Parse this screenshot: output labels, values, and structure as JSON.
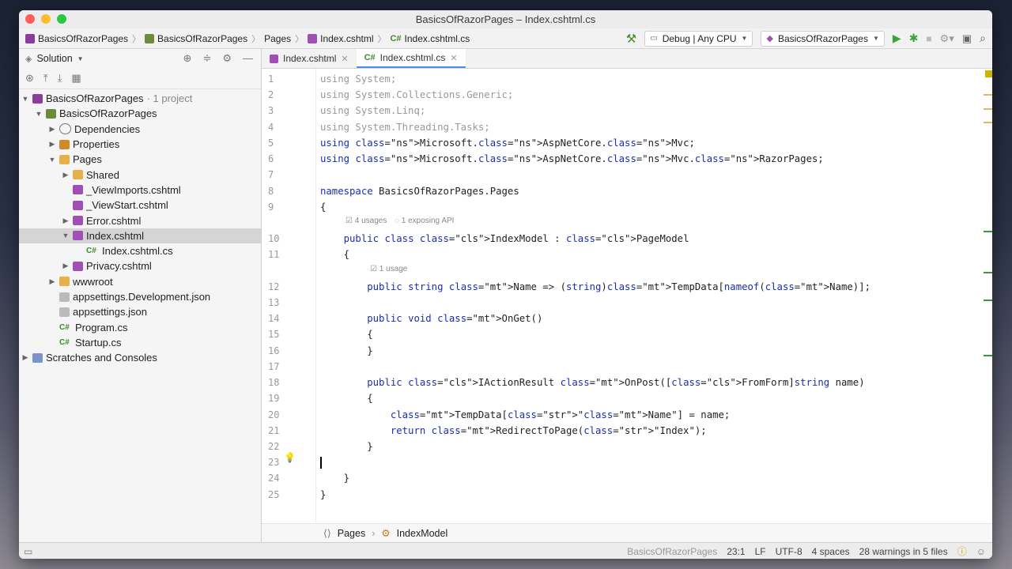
{
  "window": {
    "title": "BasicsOfRazorPages – Index.cshtml.cs"
  },
  "toolbar": {
    "breadcrumb": [
      "BasicsOfRazorPages",
      "BasicsOfRazorPages",
      "Pages",
      "Index.cshtml",
      "Index.cshtml.cs"
    ],
    "config": "Debug | Any CPU",
    "run_target": "BasicsOfRazorPages"
  },
  "sidebar": {
    "header": "Solution",
    "tree": [
      {
        "label": "BasicsOfRazorPages",
        "note": "· 1 project",
        "depth": 0,
        "arrow": "open",
        "icon": "solution",
        "selected": false
      },
      {
        "label": "BasicsOfRazorPages",
        "note": "",
        "depth": 1,
        "arrow": "open",
        "icon": "project",
        "selected": false
      },
      {
        "label": "Dependencies",
        "note": "",
        "depth": 2,
        "arrow": "closed",
        "icon": "dependencies",
        "selected": false
      },
      {
        "label": "Properties",
        "note": "",
        "depth": 2,
        "arrow": "closed",
        "icon": "properties",
        "selected": false
      },
      {
        "label": "Pages",
        "note": "",
        "depth": 2,
        "arrow": "open",
        "icon": "folder",
        "selected": false
      },
      {
        "label": "Shared",
        "note": "",
        "depth": 3,
        "arrow": "closed",
        "icon": "folder",
        "selected": false
      },
      {
        "label": "_ViewImports.cshtml",
        "note": "",
        "depth": 3,
        "arrow": "none",
        "icon": "razor",
        "selected": false
      },
      {
        "label": "_ViewStart.cshtml",
        "note": "",
        "depth": 3,
        "arrow": "none",
        "icon": "razor",
        "selected": false
      },
      {
        "label": "Error.cshtml",
        "note": "",
        "depth": 3,
        "arrow": "closed",
        "icon": "razor",
        "selected": false
      },
      {
        "label": "Index.cshtml",
        "note": "",
        "depth": 3,
        "arrow": "open",
        "icon": "razor",
        "selected": true
      },
      {
        "label": "Index.cshtml.cs",
        "note": "",
        "depth": 4,
        "arrow": "none",
        "icon": "csharp",
        "selected": false
      },
      {
        "label": "Privacy.cshtml",
        "note": "",
        "depth": 3,
        "arrow": "closed",
        "icon": "razor",
        "selected": false
      },
      {
        "label": "wwwroot",
        "note": "",
        "depth": 2,
        "arrow": "closed",
        "icon": "folder",
        "selected": false
      },
      {
        "label": "appsettings.Development.json",
        "note": "",
        "depth": 2,
        "arrow": "none",
        "icon": "json",
        "selected": false
      },
      {
        "label": "appsettings.json",
        "note": "",
        "depth": 2,
        "arrow": "none",
        "icon": "json",
        "selected": false
      },
      {
        "label": "Program.cs",
        "note": "",
        "depth": 2,
        "arrow": "none",
        "icon": "csharp",
        "selected": false
      },
      {
        "label": "Startup.cs",
        "note": "",
        "depth": 2,
        "arrow": "none",
        "icon": "csharp",
        "selected": false
      },
      {
        "label": "Scratches and Consoles",
        "note": "",
        "depth": 0,
        "arrow": "closed",
        "icon": "scratches",
        "selected": false
      }
    ]
  },
  "tabs": [
    {
      "label": "Index.cshtml",
      "prefix": "",
      "active": false
    },
    {
      "label": "Index.cshtml.cs",
      "prefix": "C#",
      "active": true
    }
  ],
  "hints": {
    "usages_class": "4 usages",
    "exposing_api": "1 exposing API",
    "usage_name": "1 usage"
  },
  "code_lines": [
    "using System;",
    "using System.Collections.Generic;",
    "using System.Linq;",
    "using System.Threading.Tasks;",
    "using Microsoft.AspNetCore.Mvc;",
    "using Microsoft.AspNetCore.Mvc.RazorPages;",
    "",
    "namespace BasicsOfRazorPages.Pages",
    "{",
    "    public class IndexModel : PageModel",
    "    {",
    "        public string Name => (string)TempData[nameof(Name)];",
    "",
    "        public void OnGet()",
    "        {",
    "        }",
    "",
    "        public IActionResult OnPost([FromForm]string name)",
    "        {",
    "            TempData[\"Name\"] = name;",
    "            return RedirectToPage(\"Index\");",
    "        }",
    "",
    "    }",
    "}"
  ],
  "bottom_breadcrumb": [
    "Pages",
    "IndexModel"
  ],
  "status": {
    "project": "BasicsOfRazorPages",
    "position": "23:1",
    "line_ending": "LF",
    "encoding": "UTF-8",
    "indent": "4 spaces",
    "warnings": "28 warnings in 5 files"
  },
  "colors": {
    "accent": "#4a90e2",
    "keyword": "#1a2fb0",
    "class": "#7a1f8a",
    "method": "#3b8b8b",
    "string": "#2b6e19"
  }
}
